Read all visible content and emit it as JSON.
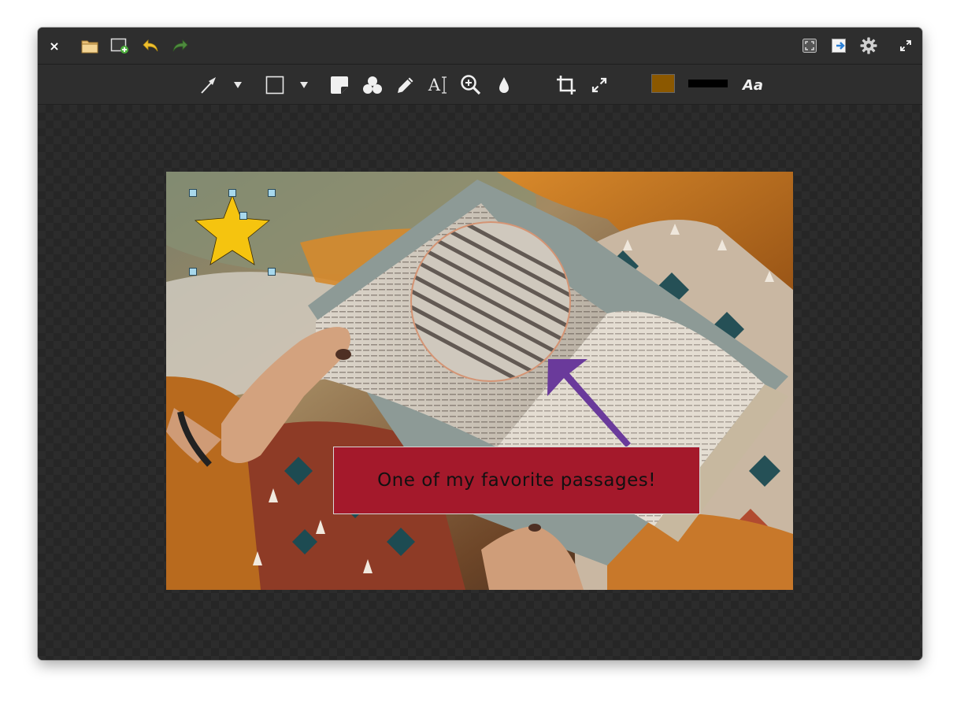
{
  "titlebar": {
    "buttons": [
      {
        "name": "close-icon"
      },
      {
        "name": "open-folder-icon"
      },
      {
        "name": "new-capture-icon"
      },
      {
        "name": "undo-icon"
      },
      {
        "name": "redo-icon"
      },
      {
        "name": "fit-screen-icon"
      },
      {
        "name": "export-icon"
      },
      {
        "name": "settings-gear-icon"
      },
      {
        "name": "maximize-icon"
      }
    ],
    "close_glyph": "×"
  },
  "toolbar": {
    "tools": [
      "arrow-tool-icon",
      "arrow-options-dropdown",
      "rectangle-tool-icon",
      "shape-options-dropdown",
      "sticker-tool-icon",
      "blur-tool-icon",
      "pen-tool-icon",
      "text-tool-icon",
      "magnify-tool-icon",
      "drop-fill-icon",
      "crop-tool-icon",
      "resize-tool-icon",
      "color-swatch",
      "line-width-swatch",
      "font-style-icon"
    ],
    "text_tool_glyph": "A",
    "font_style_glyph": "Aa",
    "current_color": "#8b5800",
    "line_color": "#000000"
  },
  "annotations": {
    "callout_text": "One of my favorite passages!",
    "callout_color": "#a4192b",
    "star_color": "#f5c40f",
    "arrow_color": "#6a3a9b",
    "magnifier_ring_color": "#d49474"
  }
}
